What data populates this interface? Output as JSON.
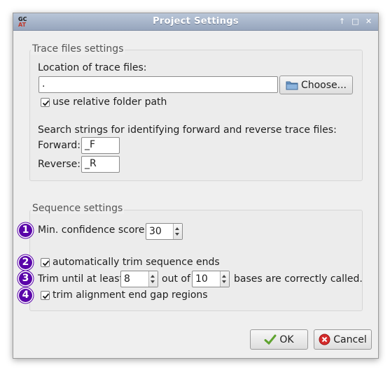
{
  "window": {
    "title": "Project Settings",
    "icon_text_top": "GC",
    "icon_text_bottom": "AT"
  },
  "titlebar_buttons": [
    "↑",
    "□",
    "✕"
  ],
  "trace_group": {
    "title": "Trace files settings",
    "location_label": "Location of trace files:",
    "location_value": ".",
    "choose_label": "Choose...",
    "relative_label": "use relative folder path",
    "relative_checked": true,
    "search_label": "Search strings for identifying forward and reverse trace files:",
    "forward_label": "Forward:",
    "forward_value": "_F",
    "reverse_label": "Reverse:",
    "reverse_value": "_R"
  },
  "sequence_group": {
    "title": "Sequence settings",
    "min_conf_label": "Min. confidence score:",
    "min_conf_value": "30",
    "auto_trim_label": "automatically trim sequence ends",
    "auto_trim_checked": true,
    "trim_prefix": "Trim until at least",
    "trim_value": "8",
    "trim_mid": "out of",
    "trim_window": "10",
    "trim_suffix": "bases are correctly called.",
    "gap_label": "trim alignment end gap regions",
    "gap_checked": true
  },
  "badges": [
    "1",
    "2",
    "3",
    "4"
  ],
  "badge_color": "#5a05a9",
  "buttons": {
    "ok": "OK",
    "cancel": "Cancel"
  }
}
